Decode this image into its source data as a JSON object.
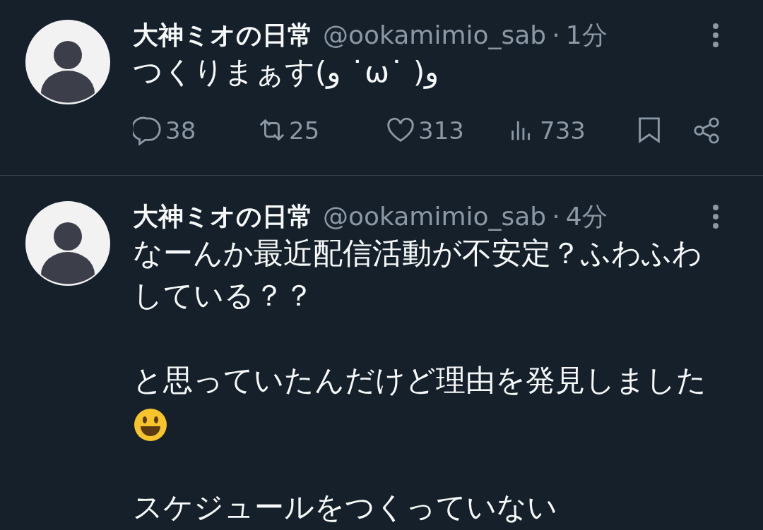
{
  "tweets": [
    {
      "author": "大神ミオの日常",
      "handle": "@ookamimio_sab",
      "separator": "·",
      "time": "1分",
      "body": [
        {
          "kind": "plain",
          "text": "つくりまぁす(و ˙ω˙ )و"
        }
      ],
      "actions": {
        "replies": "38",
        "reposts": "25",
        "likes": "313",
        "views": "733"
      }
    },
    {
      "author": "大神ミオの日常",
      "handle": "@ookamimio_sab",
      "separator": "·",
      "time": "4分",
      "body": [
        {
          "kind": "plain",
          "text": "なーんか最近配信活動が不安定？ふわふわしている？？"
        },
        {
          "kind": "with_emoji",
          "text": "と思っていたんだけど理由を発見しました"
        },
        {
          "kind": "plain",
          "text": "スケジュールをつくっていない"
        }
      ]
    }
  ]
}
